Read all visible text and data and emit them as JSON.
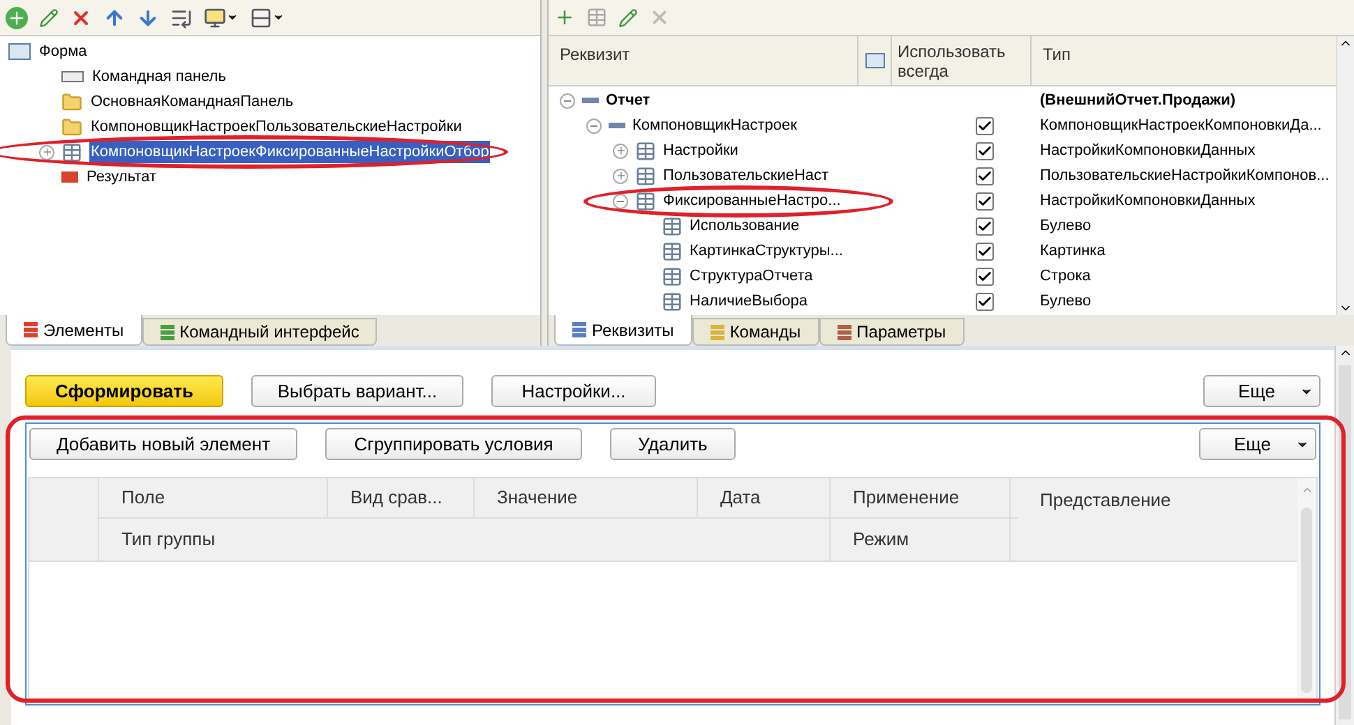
{
  "elements_panel": {
    "tree": [
      {
        "label": "Форма",
        "kind": "form",
        "children": [
          {
            "label": "Командная панель",
            "kind": "command-bar",
            "selected": false
          },
          {
            "label": "ОсновнаяКоманднаяПанель",
            "kind": "folder",
            "selected": false
          },
          {
            "label": "КомпоновщикНастроекПользовательскиеНастройки",
            "kind": "folder",
            "selected": false
          },
          {
            "label": "КомпоновщикНастроекФиксированныеНастройкиОтбор",
            "kind": "table",
            "selected": true,
            "expanded": false
          },
          {
            "label": "Результат",
            "kind": "field",
            "selected": false
          }
        ]
      }
    ],
    "tabs": [
      {
        "label": "Элементы",
        "selected": true
      },
      {
        "label": "Командный интерфейс",
        "selected": false
      }
    ]
  },
  "attributes_panel": {
    "columns": [
      "Реквизит",
      "Использовать всегда",
      "Тип"
    ],
    "tree": [
      {
        "label": "Отчет",
        "kind": "attribute",
        "bold": true,
        "type": "(ВнешнийОтчет.Продажи)",
        "expanded": true,
        "children": [
          {
            "label": "КомпоновщикНастроек",
            "kind": "attribute",
            "checked": true,
            "type": "КомпоновщикНастроекКомпоновкиДа...",
            "expanded": true,
            "children": [
              {
                "label": "Настройки",
                "kind": "table",
                "checked": true,
                "type": "НастройкиКомпоновкиДанных",
                "expanded": false
              },
              {
                "label": "ПользовательскиеНаст",
                "kind": "table",
                "checked": true,
                "type": "ПользовательскиеНастройкиКомпонов...",
                "expanded": false
              },
              {
                "label": "ФиксированныеНастро...",
                "kind": "table",
                "checked": true,
                "type": "НастройкиКомпоновкиДанных",
                "expanded": true,
                "children": [
                  {
                    "label": "Использование",
                    "kind": "column",
                    "checked": true,
                    "type": "Булево"
                  },
                  {
                    "label": "КартинкаСтруктуры...",
                    "kind": "column",
                    "checked": true,
                    "type": "Картинка"
                  },
                  {
                    "label": "СтруктураОтчета",
                    "kind": "column",
                    "checked": true,
                    "type": "Строка"
                  },
                  {
                    "label": "НаличиеВыбора",
                    "kind": "column",
                    "checked": true,
                    "type": "Булево"
                  }
                ]
              }
            ]
          }
        ]
      }
    ],
    "tabs": [
      {
        "label": "Реквизиты",
        "selected": true,
        "color": "#5a7fc0"
      },
      {
        "label": "Команды",
        "selected": false,
        "color": "#d9b53a"
      },
      {
        "label": "Параметры",
        "selected": false,
        "color": "#b0604a"
      }
    ]
  },
  "form": {
    "command_bar": [
      {
        "label": "Сформировать",
        "kind": "default"
      },
      {
        "label": "Выбрать вариант...",
        "kind": "normal"
      },
      {
        "label": "Настройки...",
        "kind": "normal"
      }
    ],
    "more": "Еще",
    "filter": {
      "buttons": [
        "Добавить новый элемент",
        "Сгруппировать условия",
        "Удалить"
      ],
      "more": "Еще",
      "header_row_1": [
        "Поле",
        "Вид срав...",
        "Значение",
        "Дата",
        "Применение"
      ],
      "header_span": "Представление",
      "header_row_2": [
        "Тип группы",
        "Режим"
      ]
    }
  }
}
